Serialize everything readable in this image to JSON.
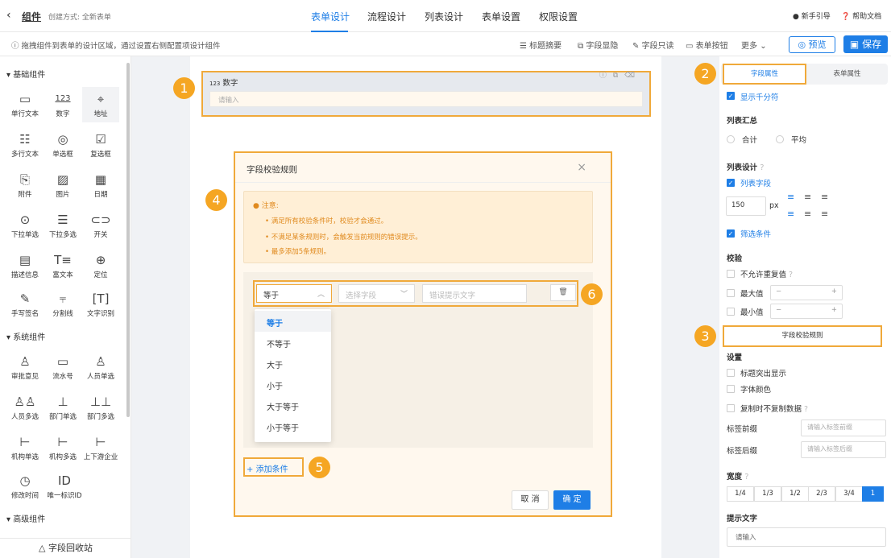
{
  "header": {
    "back_icon": "‹",
    "app_label": "组件",
    "create_mode": "创建方式: 全新表单",
    "tabs": [
      "表单设计",
      "流程设计",
      "列表设计",
      "表单设置",
      "权限设置"
    ],
    "active_tab": "表单设计",
    "guide": "新手引导",
    "help": "帮助文档"
  },
  "toolbar": {
    "hint": "拖拽组件到表单的设计区域，通过设置右侧配置项设计组件",
    "items": [
      "标题摘要",
      "字段显隐",
      "字段只读",
      "表单按钮",
      "更多"
    ],
    "preview": "预览",
    "save": "保存"
  },
  "left_panel": {
    "sections": [
      "基础组件",
      "系统组件",
      "高级组件"
    ],
    "basic": [
      "单行文本",
      "数字",
      "地址",
      "多行文本",
      "单选框",
      "复选框",
      "附件",
      "图片",
      "日期",
      "下拉单选",
      "下拉多选",
      "开关",
      "描述信息",
      "富文本",
      "定位",
      "手写签名",
      "分割线",
      "文字识别"
    ],
    "system": [
      "审批意见",
      "流水号",
      "人员单选",
      "人员多选",
      "部门单选",
      "部门多选",
      "机构单选",
      "机构多选",
      "上下游企业",
      "修改时间",
      "唯一标识ID"
    ],
    "recycle": "字段回收站"
  },
  "canvas": {
    "field_label": "数字",
    "field_prefix": "123",
    "field_placeholder": "请输入"
  },
  "badges": [
    "1",
    "2",
    "3",
    "4",
    "5",
    "6"
  ],
  "dialog": {
    "title": "字段校验规则",
    "notice_title": "注意:",
    "notices": [
      "满足所有校验条件时，校验才会通过。",
      "不满足某条规则时，会触发当前规则的错误提示。",
      "最多添加5条规则。"
    ],
    "operator": "等于",
    "field_placeholder": "选择字段",
    "error_placeholder": "错误提示文字",
    "options": [
      "等于",
      "不等于",
      "大于",
      "小于",
      "大于等于",
      "小于等于"
    ],
    "add_condition": "添加条件",
    "cancel": "取 消",
    "ok": "确 定"
  },
  "right_panel": {
    "tab_field": "字段属性",
    "tab_form": "表单属性",
    "show_thousands": "显示千分符",
    "list_summary": "列表汇总",
    "sum": "合计",
    "avg": "平均",
    "list_design": "列表设计",
    "list_field": "列表字段",
    "width_value": "150",
    "width_unit": "px",
    "filter_condition": "筛选条件",
    "validation": "校验",
    "no_duplicate": "不允许重复值",
    "max_value": "最大值",
    "min_value": "最小值",
    "rule_button": "字段校验规则",
    "settings": "设置",
    "title_highlight": "标题突出显示",
    "font_color": "字体颜色",
    "no_copy": "复制时不复制数据",
    "label_prefix": "标签前缀",
    "label_prefix_ph": "请输入标签前缀",
    "label_suffix": "标签后缀",
    "label_suffix_ph": "请输入标签后缀",
    "width": "宽度",
    "width_options": [
      "1/4",
      "1/3",
      "1/2",
      "2/3",
      "3/4",
      "1"
    ],
    "width_selected": "1",
    "hint_text": "提示文字",
    "hint_placeholder": "请输入"
  },
  "colors": {
    "accent": "#1e7ee6",
    "highlight": "#f0a93a",
    "badge": "#f5a623"
  }
}
